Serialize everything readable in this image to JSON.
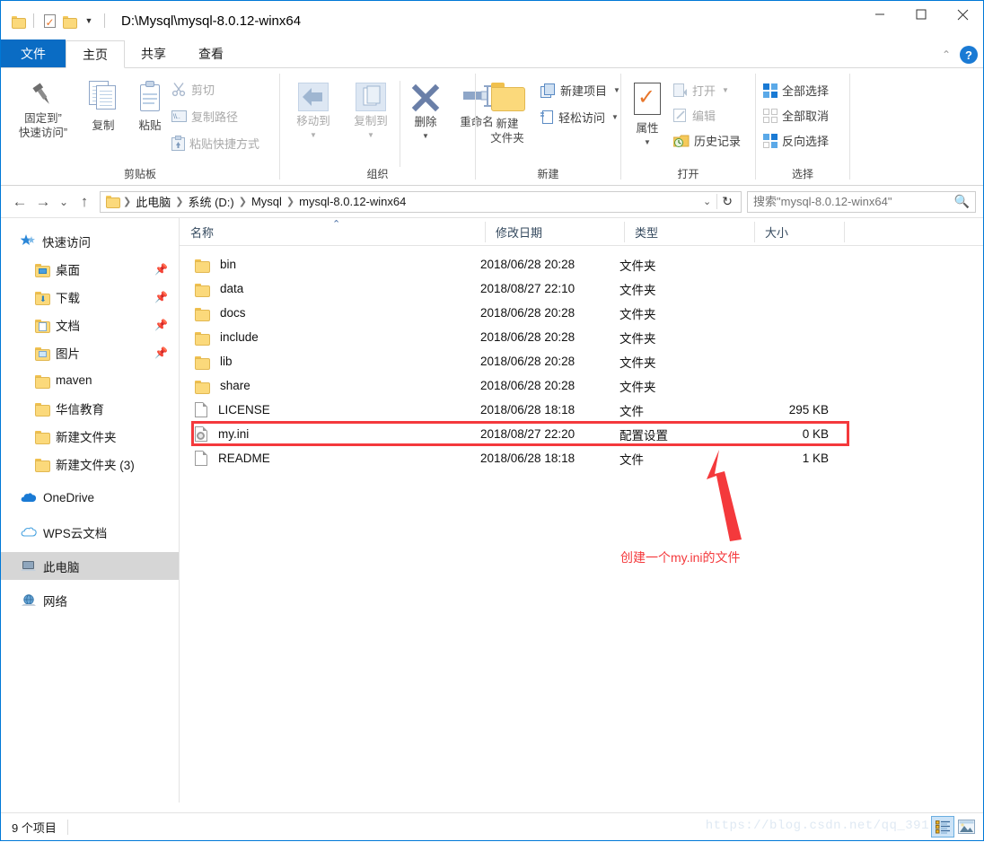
{
  "window": {
    "title": "D:\\Mysql\\mysql-8.0.12-winx64",
    "minimize": "–",
    "maximize": "□",
    "close": "✕"
  },
  "quick_access_toolbar": {
    "items": [
      "folder-icon",
      "properties-icon",
      "new-folder-icon",
      "customize-caret"
    ]
  },
  "tabs": [
    {
      "label": "文件",
      "type": "file"
    },
    {
      "label": "主页",
      "type": "active"
    },
    {
      "label": "共享",
      "type": "normal"
    },
    {
      "label": "查看",
      "type": "normal"
    }
  ],
  "tab_right": {
    "collapse": "⌃",
    "help": "?"
  },
  "ribbon": {
    "groups": [
      {
        "label": "剪贴板"
      },
      {
        "label": "组织"
      },
      {
        "label": "新建"
      },
      {
        "label": "打开"
      },
      {
        "label": "选择"
      }
    ],
    "clipboard": {
      "pin_line1": "固定到”",
      "pin_line2": "快速访问”",
      "copy": "复制",
      "paste": "粘贴",
      "cut": "剪切",
      "copy_path": "复制路径",
      "paste_shortcut": "粘贴快捷方式"
    },
    "organize": {
      "move_to": "移动到",
      "copy_to": "复制到",
      "delete": "删除",
      "rename": "重命名"
    },
    "new": {
      "new_folder_line1": "新建",
      "new_folder_line2": "文件夹",
      "new_item": "新建项目",
      "easy_access": "轻松访问"
    },
    "open": {
      "properties": "属性",
      "open": "打开",
      "edit": "编辑",
      "history": "历史记录"
    },
    "select": {
      "select_all": "全部选择",
      "select_none": "全部取消",
      "invert": "反向选择"
    }
  },
  "address_bar": {
    "back": "←",
    "forward": "→",
    "recent": "⌄",
    "up": "↑",
    "breadcrumbs": [
      "此电脑",
      "系统 (D:)",
      "Mysql",
      "mysql-8.0.12-winx64"
    ],
    "dropdown": "⌄",
    "refresh": "↻",
    "search_placeholder": "搜索\"mysql-8.0.12-winx64\"",
    "search_value": ""
  },
  "sidebar": {
    "items": [
      {
        "label": "快速访问",
        "icon": "star-icon",
        "level": "root",
        "pinned": false,
        "selected": false
      },
      {
        "label": "桌面",
        "icon": "desktop-folder-icon",
        "level": "child",
        "pinned": true,
        "selected": false
      },
      {
        "label": "下载",
        "icon": "downloads-folder-icon",
        "level": "child",
        "pinned": true,
        "selected": false
      },
      {
        "label": "文档",
        "icon": "documents-folder-icon",
        "level": "child",
        "pinned": true,
        "selected": false
      },
      {
        "label": "图片",
        "icon": "pictures-folder-icon",
        "level": "child",
        "pinned": true,
        "selected": false
      },
      {
        "label": "maven",
        "icon": "folder-icon",
        "level": "child",
        "pinned": false,
        "selected": false
      },
      {
        "label": "华信教育",
        "icon": "folder-icon",
        "level": "child",
        "pinned": false,
        "selected": false
      },
      {
        "label": "新建文件夹",
        "icon": "folder-icon",
        "level": "child",
        "pinned": false,
        "selected": false
      },
      {
        "label": "新建文件夹 (3)",
        "icon": "folder-icon",
        "level": "child",
        "pinned": false,
        "selected": false
      },
      {
        "label": "OneDrive",
        "icon": "onedrive-icon",
        "level": "root",
        "pinned": false,
        "selected": false
      },
      {
        "label": "WPS云文档",
        "icon": "cloud-icon",
        "level": "root",
        "pinned": false,
        "selected": false
      },
      {
        "label": "此电脑",
        "icon": "this-pc-icon",
        "level": "root",
        "pinned": false,
        "selected": true
      },
      {
        "label": "网络",
        "icon": "network-icon",
        "level": "root",
        "pinned": false,
        "selected": false
      }
    ]
  },
  "file_list": {
    "columns": [
      "名称",
      "修改日期",
      "类型",
      "大小"
    ],
    "sort_column": 0,
    "sort_direction": "asc",
    "rows": [
      {
        "name": "bin",
        "icon": "folder-icon",
        "date": "2018/06/28 20:28",
        "type": "文件夹",
        "size": "",
        "highlighted": false
      },
      {
        "name": "data",
        "icon": "folder-icon",
        "date": "2018/08/27 22:10",
        "type": "文件夹",
        "size": "",
        "highlighted": false
      },
      {
        "name": "docs",
        "icon": "folder-icon",
        "date": "2018/06/28 20:28",
        "type": "文件夹",
        "size": "",
        "highlighted": false
      },
      {
        "name": "include",
        "icon": "folder-icon",
        "date": "2018/06/28 20:28",
        "type": "文件夹",
        "size": "",
        "highlighted": false
      },
      {
        "name": "lib",
        "icon": "folder-icon",
        "date": "2018/06/28 20:28",
        "type": "文件夹",
        "size": "",
        "highlighted": false
      },
      {
        "name": "share",
        "icon": "folder-icon",
        "date": "2018/06/28 20:28",
        "type": "文件夹",
        "size": "",
        "highlighted": false
      },
      {
        "name": "LICENSE",
        "icon": "file-icon",
        "date": "2018/06/28 18:18",
        "type": "文件",
        "size": "295 KB",
        "highlighted": false
      },
      {
        "name": "my.ini",
        "icon": "ini-file-icon",
        "date": "2018/08/27 22:20",
        "type": "配置设置",
        "size": "0 KB",
        "highlighted": true
      },
      {
        "name": "README",
        "icon": "file-icon",
        "date": "2018/06/28 18:18",
        "type": "文件",
        "size": "1 KB",
        "highlighted": false
      }
    ]
  },
  "annotation": {
    "text": "创建一个my.ini的文件",
    "color": "#f4393c",
    "arrow": "arrow-pointing-to-my-ini-row"
  },
  "status_bar": {
    "item_count": "9 个项目",
    "watermark": "https://blog.csdn.net/qq_391",
    "view_details": "details-view-icon",
    "view_large_icons": "large-icons-view-icon"
  }
}
